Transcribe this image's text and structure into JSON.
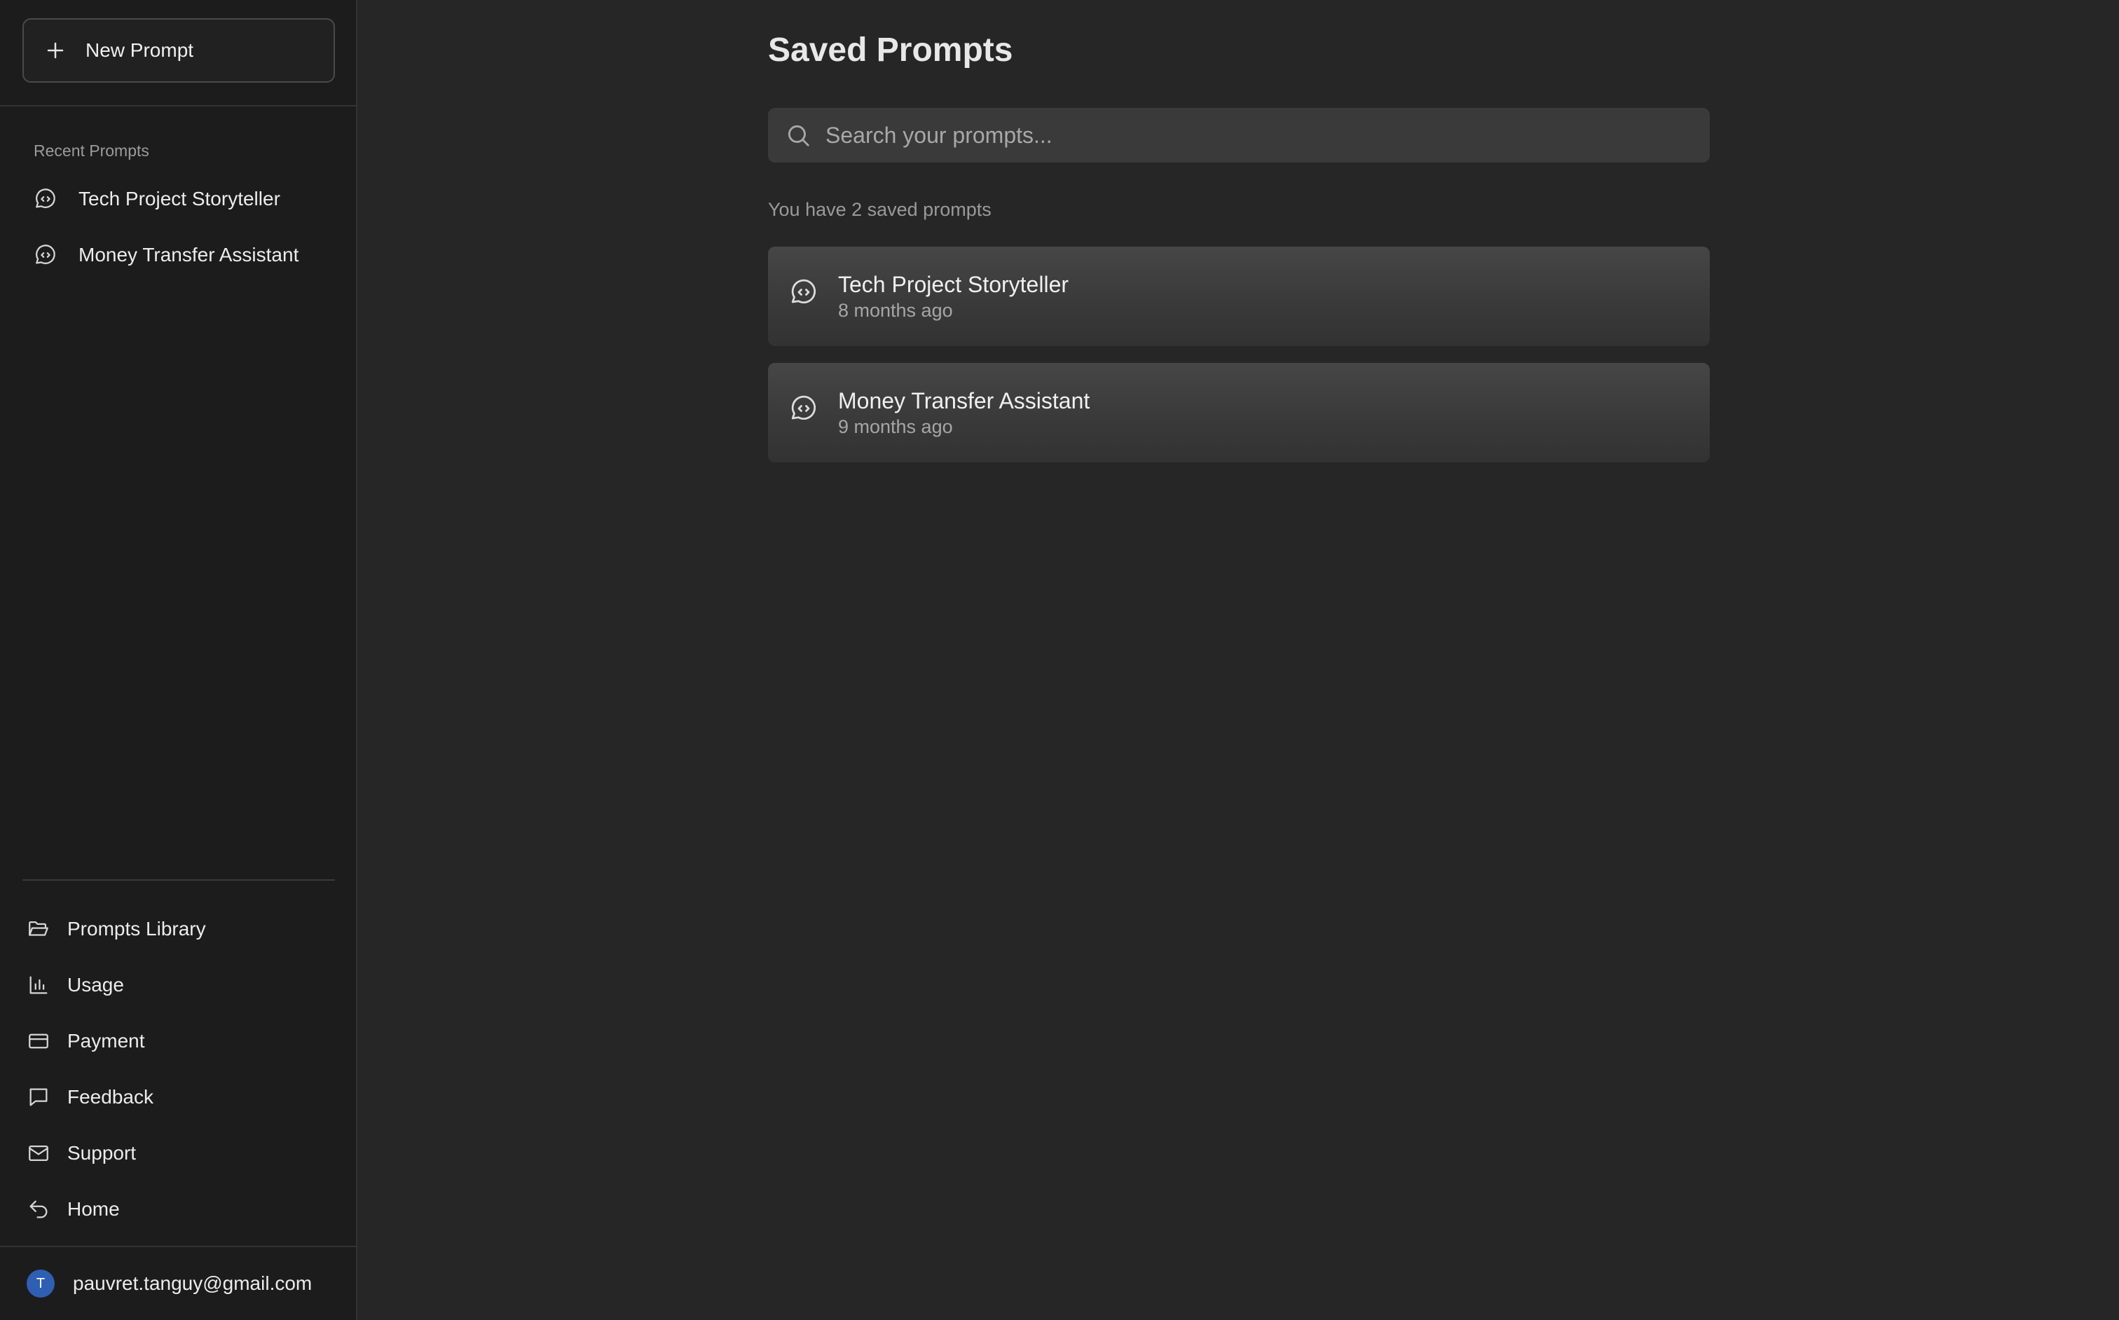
{
  "sidebar": {
    "new_prompt_label": "New Prompt",
    "recent_heading": "Recent Prompts",
    "recent_items": [
      {
        "label": "Tech Project Storyteller",
        "icon": "message-code-icon"
      },
      {
        "label": "Money Transfer Assistant",
        "icon": "message-code-icon"
      }
    ],
    "nav_items": [
      {
        "label": "Prompts Library",
        "icon": "folder-open-icon"
      },
      {
        "label": "Usage",
        "icon": "bar-chart-icon"
      },
      {
        "label": "Payment",
        "icon": "credit-card-icon"
      },
      {
        "label": "Feedback",
        "icon": "message-square-icon"
      },
      {
        "label": "Support",
        "icon": "mail-icon"
      },
      {
        "label": "Home",
        "icon": "undo-arrow-icon"
      }
    ],
    "account": {
      "avatar_initial": "T",
      "email": "pauvret.tanguy@gmail.com"
    }
  },
  "main": {
    "title": "Saved Prompts",
    "search": {
      "placeholder": "Search your prompts...",
      "value": ""
    },
    "count_text": "You have 2 saved prompts",
    "prompts": [
      {
        "title": "Tech Project Storyteller",
        "time": "8 months ago",
        "icon": "message-code-icon"
      },
      {
        "title": "Money Transfer Assistant",
        "time": "9 months ago",
        "icon": "message-code-icon"
      }
    ]
  },
  "colors": {
    "background": "#262626",
    "sidebar": "#1c1c1c",
    "card": "#3a3a3a",
    "avatar": "#2f5fb3"
  }
}
